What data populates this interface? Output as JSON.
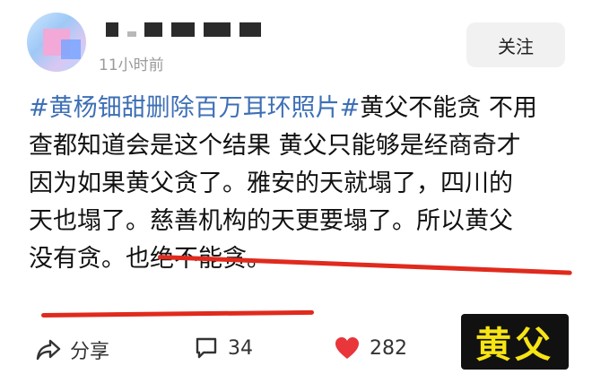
{
  "header": {
    "username": "",
    "time": "11小时前",
    "follow_label": "关注"
  },
  "post": {
    "lines": [
      {
        "topic": "#黄杨钿甜删除百万耳环照片#",
        "text": "黄父不能贪 不用"
      },
      {
        "text": "查都知道会是这个结果 黄父只能够是经商奇才"
      },
      {
        "text": "因为如果黄父贪了。雅安的天就塌了，四川的"
      },
      {
        "text": "天也塌了。慈善机构的天更要塌了。所以黄父"
      },
      {
        "text": "没有贪。也绝不能贪。"
      }
    ]
  },
  "actions": {
    "share_label": "分享",
    "comment_count": "34",
    "like_count": "282"
  },
  "overlay": {
    "badge_text": "黄父",
    "badge_bg": "#111111",
    "badge_color": "#f7e414",
    "underline_color": "#e02a1d"
  },
  "colors": {
    "topic": "#3d6fb5",
    "like": "#e8363b"
  },
  "icons": [
    "share-icon",
    "comment-icon",
    "heart-icon"
  ]
}
